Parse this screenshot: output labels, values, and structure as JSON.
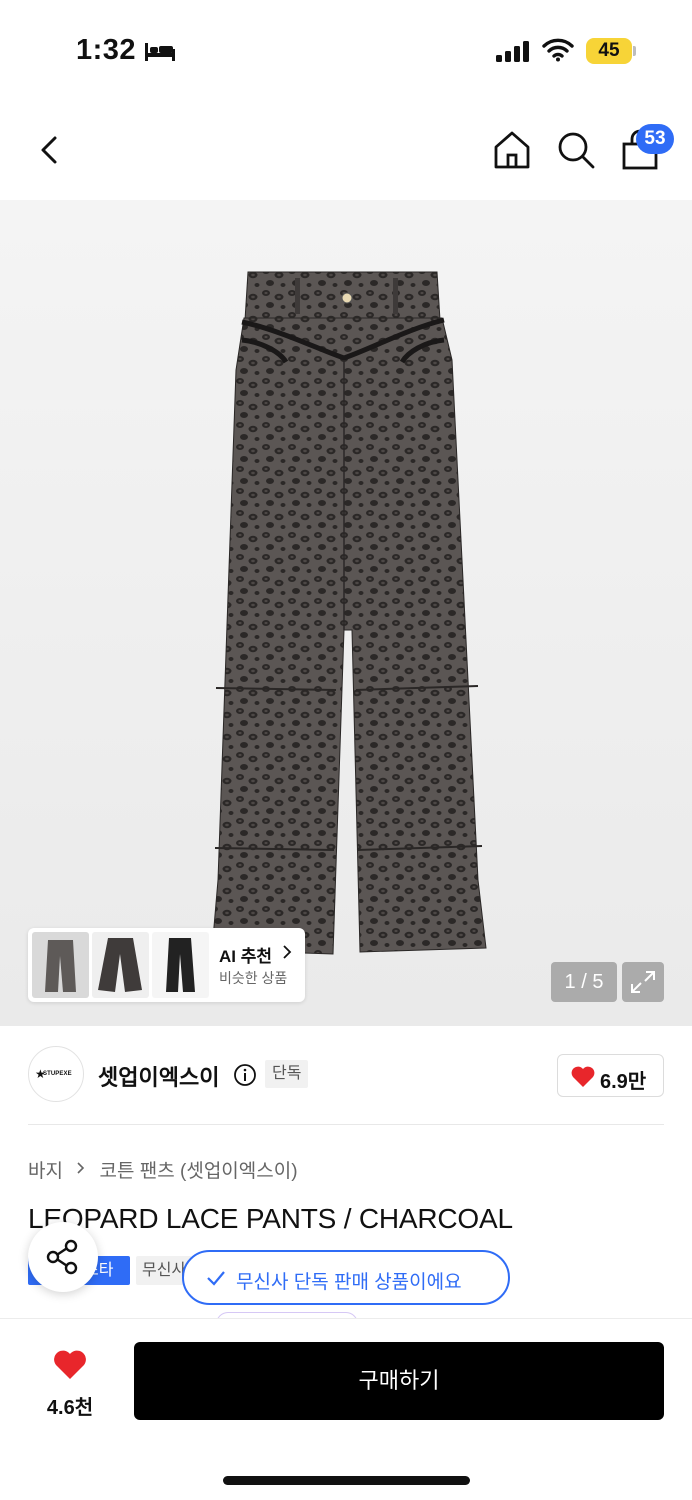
{
  "status_bar": {
    "time": "1:32",
    "battery": "45"
  },
  "nav": {
    "cart_count": "53"
  },
  "gallery": {
    "ai_title": "AI 추천",
    "ai_subtitle": "비슷한 상품",
    "counter": "1 / 5"
  },
  "brand": {
    "logo_text": "STUPEXE",
    "name": "셋업이엑스이",
    "exclusive_tag": "단독",
    "likes": "6.9만"
  },
  "product": {
    "breadcrumb": [
      "바지",
      "코튼 팬츠 (셋업이엑스이)"
    ],
    "title": "LEOPARD LACE PANTS / CHARCOAL",
    "tag_blue": "스타",
    "tag_gray": "무신사"
  },
  "toast": {
    "text": "무신사 단독 판매 상품이에요"
  },
  "bottom_bar": {
    "likes": "4.6천",
    "buy_label": "구매하기"
  },
  "colors": {
    "accent": "#2f6cf6",
    "heart": "#e8262b",
    "battery": "#f7d437",
    "buy_button": "#000000"
  }
}
